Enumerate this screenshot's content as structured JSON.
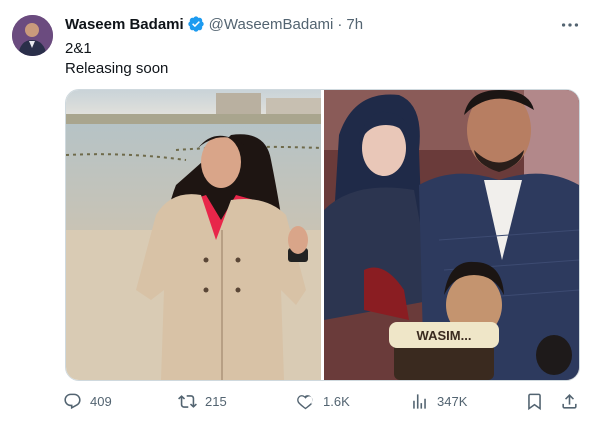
{
  "author": {
    "name": "Waseem Badami",
    "handle": "@WaseemBadami",
    "separator": "·",
    "time": "7h"
  },
  "tweet": {
    "line1": "2&1",
    "line2": "Releasing soon",
    "image_badge_text": "WASIM..."
  },
  "actions": {
    "replies": "409",
    "retweets": "215",
    "likes": "1.6K",
    "views": "347K"
  },
  "icons": [
    "verified-badge-icon",
    "more-icon",
    "reply-icon",
    "retweet-icon",
    "like-icon",
    "views-icon",
    "bookmark-icon",
    "share-icon"
  ],
  "colors": {
    "verified": "#1d9bf0",
    "secondary_text": "#536471",
    "border": "#cfd9de"
  }
}
